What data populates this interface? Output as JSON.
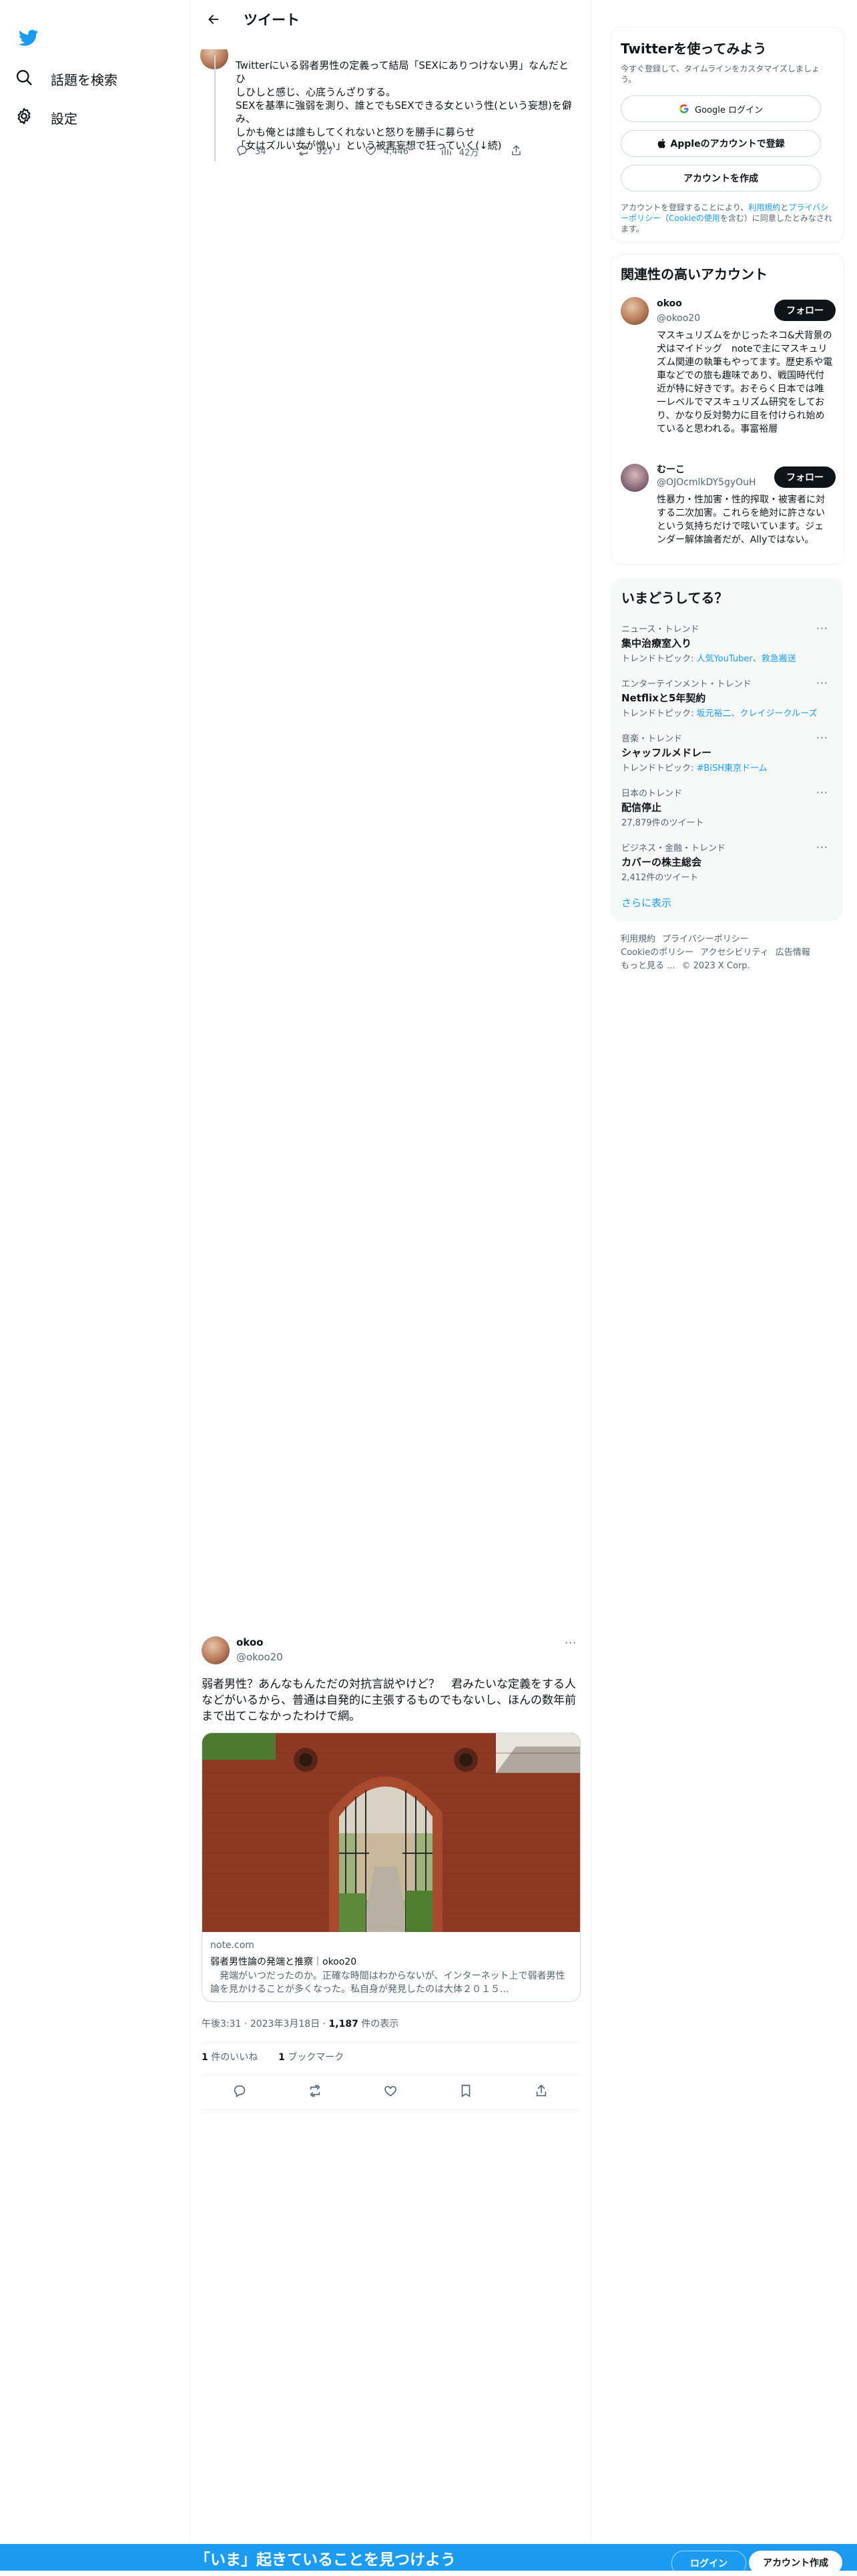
{
  "nav": {
    "explore_label": "話題を検索",
    "settings_label": "設定"
  },
  "header": {
    "title": "ツイート"
  },
  "tweet1": {
    "lines": [
      "Twitterにいる弱者男性の定義って結局「SEXにありつけない男」なんだとひ",
      "しひしと感じ、心底うんざりする。",
      "SEXを基準に強弱を測り、誰とでもSEXできる女という性(という妄想)を僻",
      "み、",
      "しかも俺とは誰もしてくれないと怒りを勝手に募らせ",
      "「女はズルい女が憎い」という被害妄想で狂っていく(↓続)"
    ],
    "reply_count": "34",
    "retweet_count": "927",
    "like_count": "4,446",
    "view_count": "42万"
  },
  "signup_card": {
    "title": "Twitterを使ってみよう",
    "subtitle": "今すぐ登録して、タイムラインをカスタマイズしましょう。",
    "google_label": "Google ログイン",
    "apple_label": "Appleのアカウントで登録",
    "create_label": "アカウントを作成",
    "legal_prefix": "アカウントを登録することにより、",
    "terms": "利用規約",
    "and": "と",
    "privacy": "プライバシーポリシー",
    "cookie_open": "（",
    "cookie": "Cookieの使用",
    "legal_suffix": "を含む）に同意したとみなされます。"
  },
  "related": {
    "title": "関連性の高いアカウント",
    "accounts": [
      {
        "name": "okoo",
        "handle": "@okoo20",
        "follow": "フォロー",
        "bio": "マスキュリズムをかじったネコ&犬背景の犬はマイドッグ　noteで主にマスキュリズム関連の執筆もやってます。歴史系や電車などでの旅も趣味であり、戦国時代付近が特に好きです。おそらく日本では唯一レベルでマスキュリズム研究をしており、かなり反対勢力に目を付けられ始めていると思われる。事富裕層"
      },
      {
        "name": "むーこ",
        "handle": "@OJOcmlkDY5gyOuH",
        "follow": "フォロー",
        "bio": "性暴力・性加害・性的搾取・被害者に対する二次加害。これらを絶対に許さないという気持ちだけで呟いています。ジェンダー解体論者だが、Allyではない。"
      }
    ]
  },
  "trends": {
    "title": "いまどうしてる？",
    "items": [
      {
        "category": "ニュース・トレンド",
        "name": "集中治療室入り",
        "topic_prefix": "トレンドトピック: ",
        "topic": "人気YouTuber、救急搬送"
      },
      {
        "category": "エンターテインメント・トレンド",
        "name": "Netflixと5年契約",
        "topic_prefix": "トレンドトピック: ",
        "topic": "坂元裕二、クレイジークルーズ"
      },
      {
        "category": "音楽・トレンド",
        "name": "シャッフルメドレー",
        "topic_prefix": "トレンドトピック: ",
        "topic": "#BiSH東京ドーム"
      },
      {
        "category": "日本のトレンド",
        "name": "配信停止",
        "count": "27,879件のツイート"
      },
      {
        "category": "ビジネス・金融・トレンド",
        "name": "カバーの株主総会",
        "count": "2,412件のツイート"
      }
    ],
    "show_more": "さらに表示"
  },
  "footer": {
    "links": [
      "利用規約",
      "プライバシーポリシー",
      "Cookieのポリシー",
      "アクセシビリティ",
      "広告情報",
      "もっと見る ..."
    ],
    "copyright": "© 2023 X Corp."
  },
  "tweet2": {
    "name": "okoo",
    "handle": "@okoo20",
    "text_lines": [
      "弱者男性？あんなもんただの対抗言説やけど？　君みたいな定義をする人",
      "などがいるから、普通は自発的に主張するものでもないし、ほんの数年前",
      "まで出てこなかったわけで網。"
    ],
    "card_domain": "note.com",
    "card_title": "弱者男性論の発端と推察｜okoo20",
    "card_desc": "　発端がいつだったのか。正確な時間はわからないが、インターネット上で弱者男性論を見かけることが多くなった。私自身が発見したのは大体２０１５...",
    "time": "午後3:31",
    "sep": "·",
    "date": "2023年3月18日",
    "views_num": "1,187",
    "views_label": "件の表示",
    "likes_num": "1",
    "likes_label": "件のいいね",
    "bookmarks_num": "1",
    "bookmarks_label": "ブックマーク"
  },
  "banner": {
    "message": "「いま」起きていることを見つけよう",
    "login": "ログイン",
    "signup": "アカウント作成"
  },
  "colors": {
    "accent": "#1d9bf0",
    "text": "#0f1419",
    "muted": "#536471"
  }
}
